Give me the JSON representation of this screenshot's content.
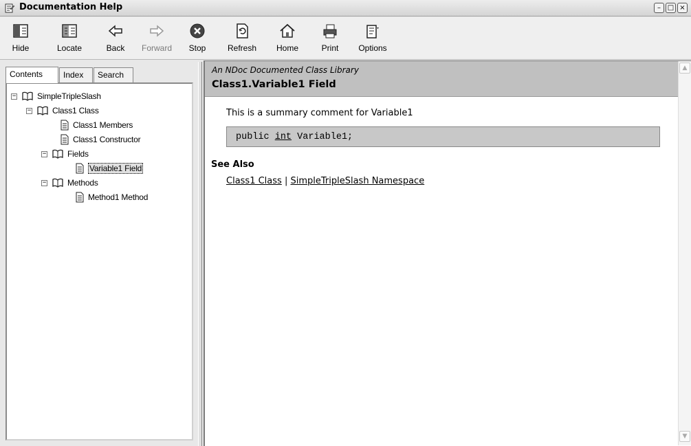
{
  "window": {
    "title": "Documentation Help",
    "controls": {
      "minimize": "–",
      "maximize": "□",
      "close": "×"
    }
  },
  "toolbar": {
    "buttons": [
      {
        "label": "Hide",
        "icon": "hide-icon"
      },
      {
        "label": "Locate",
        "icon": "locate-icon"
      },
      {
        "label": "Back",
        "icon": "back-arrow-icon"
      },
      {
        "label": "Forward",
        "icon": "forward-arrow-icon",
        "disabled": true
      },
      {
        "label": "Stop",
        "icon": "stop-icon"
      },
      {
        "label": "Refresh",
        "icon": "refresh-icon"
      },
      {
        "label": "Home",
        "icon": "home-icon"
      },
      {
        "label": "Print",
        "icon": "print-icon"
      },
      {
        "label": "Options",
        "icon": "options-icon"
      }
    ]
  },
  "nav": {
    "tabs": [
      {
        "label": "Contents",
        "active": true
      },
      {
        "label": "Index"
      },
      {
        "label": "Search"
      }
    ],
    "tree": [
      {
        "label": "SimpleTripleSlash",
        "type": "book",
        "expanded": true
      },
      {
        "label": "Class1 Class",
        "type": "book",
        "expanded": true
      },
      {
        "label": "Class1 Members",
        "type": "page"
      },
      {
        "label": "Class1 Constructor",
        "type": "page"
      },
      {
        "label": "Fields",
        "type": "book",
        "expanded": true
      },
      {
        "label": "Variable1 Field",
        "type": "page",
        "selected": true
      },
      {
        "label": "Methods",
        "type": "book",
        "expanded": true
      },
      {
        "label": "Method1 Method",
        "type": "page"
      }
    ]
  },
  "content": {
    "subtitle": "An NDoc Documented Class Library",
    "title": "Class1.Variable1 Field",
    "summary": "This is a summary comment for Variable1",
    "code": {
      "keyword": "public",
      "type": "int",
      "name": "Variable1;"
    },
    "see_also": {
      "heading": "See Also",
      "links": [
        "Class1 Class",
        "SimpleTripleSlash Namespace"
      ],
      "separator": "|"
    }
  },
  "colors": {
    "banner_bg": "#c0c0c0",
    "code_bg": "#c8c8c8",
    "window_bg": "#e8e8e8"
  }
}
